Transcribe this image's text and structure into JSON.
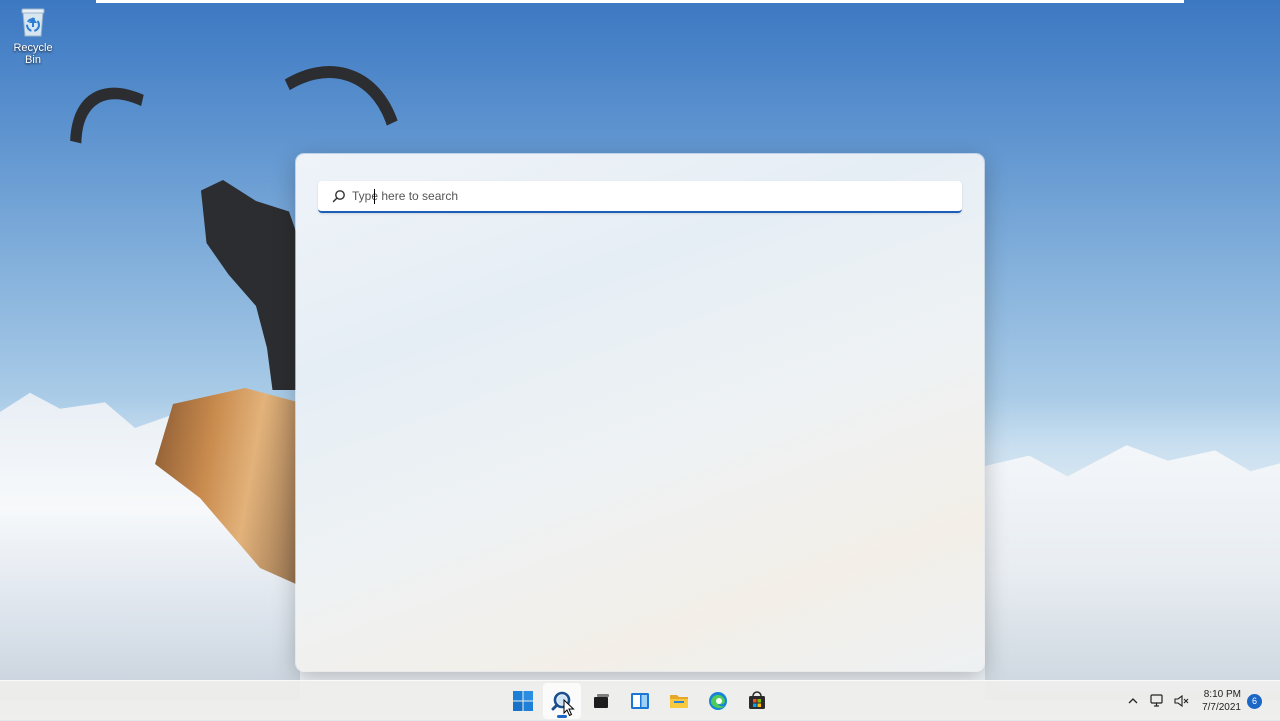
{
  "desktop": {
    "icons": [
      {
        "label": "Recycle Bin",
        "icon": "recycle-bin-icon"
      }
    ]
  },
  "search_flyout": {
    "placeholder": "Type here to search",
    "value": "",
    "accent": "#1c5fb8"
  },
  "taskbar": {
    "apps": [
      {
        "name": "Start",
        "icon": "windows-start-icon",
        "active": false
      },
      {
        "name": "Search",
        "icon": "search-icon",
        "active": true
      },
      {
        "name": "Task View",
        "icon": "task-view-icon",
        "active": false
      },
      {
        "name": "Widgets",
        "icon": "widgets-icon",
        "active": false
      },
      {
        "name": "File Explorer",
        "icon": "file-explorer-icon",
        "active": false
      },
      {
        "name": "Microsoft Edge",
        "icon": "edge-icon",
        "active": false
      },
      {
        "name": "Microsoft Store",
        "icon": "store-icon",
        "active": false
      }
    ],
    "tray": {
      "icons": [
        "chevron-up-icon",
        "network-icon",
        "volume-muted-icon"
      ],
      "time": "8:10 PM",
      "date": "7/7/2021",
      "notification_count": "6"
    }
  },
  "colors": {
    "accent_blue": "#1c66c6",
    "taskbar_bg": "#eeeeec"
  }
}
